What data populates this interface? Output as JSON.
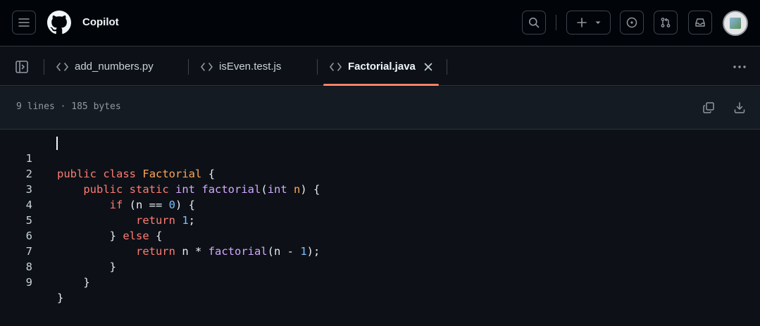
{
  "header": {
    "title": "Copilot",
    "icons": {
      "menu": "hamburger-icon",
      "logo": "github-logo",
      "search": "search-icon",
      "new": "plus-icon",
      "new_caret": "triangle-down-icon",
      "issues": "issue-opened-icon",
      "pulls": "git-pull-request-icon",
      "inbox": "inbox-icon"
    }
  },
  "tabs": [
    {
      "label": "add_numbers.py",
      "active": false
    },
    {
      "label": "isEven.test.js",
      "active": false
    },
    {
      "label": "Factorial.java",
      "active": true
    }
  ],
  "file": {
    "info": "9 lines · 185 bytes"
  },
  "code": {
    "line_numbers": [
      "1",
      "2",
      "3",
      "4",
      "5",
      "6",
      "7",
      "8",
      "9"
    ],
    "tokens": {
      "l1": [
        "public",
        "class",
        "Factorial",
        "{"
      ],
      "l2": [
        "public",
        "static",
        "int",
        "factorial",
        "(",
        "int",
        "n",
        ") {"
      ],
      "l3": [
        "if",
        "(n == ",
        "0",
        ") {"
      ],
      "l4": [
        "return",
        "1",
        ";"
      ],
      "l5": [
        "} ",
        "else",
        " {"
      ],
      "l6": [
        "return",
        " n * ",
        "factorial",
        "(n - ",
        "1",
        ");"
      ],
      "l7": [
        "}"
      ],
      "l8": [
        "}"
      ],
      "l9": [
        "}"
      ]
    }
  },
  "colors": {
    "accent_underline": "#f78166",
    "keyword": "#ff7b72",
    "type": "#ffa657",
    "function": "#d2a8ff",
    "number": "#79c0ff"
  }
}
